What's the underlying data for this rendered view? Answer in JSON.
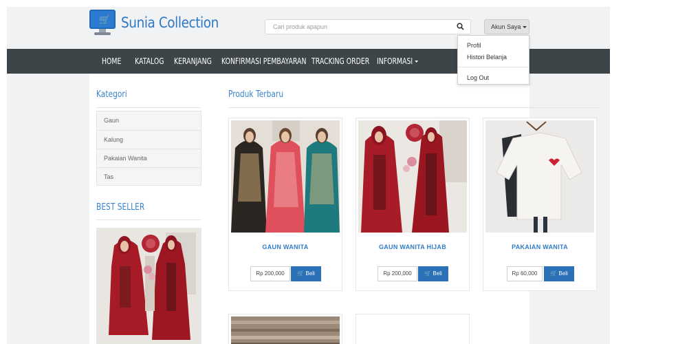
{
  "header": {
    "brand": "Sunia Collection",
    "search_placeholder": "Cari produk apapun",
    "account_label": "Akun Saya"
  },
  "account_menu": [
    "Profil",
    "Histori Belanja",
    "Log Out"
  ],
  "nav": [
    "HOME",
    "KATALOG",
    "KERANJANG",
    "KONFIRMASI PEMBAYARAN",
    "TRACKING ORDER",
    "INFORMASI"
  ],
  "sidebar": {
    "category_title": "Kategori",
    "categories": [
      "Gaun",
      "Kalung",
      "Pakaian Wanita",
      "Tas"
    ],
    "bestseller_title": "BEST SELLER"
  },
  "main": {
    "title": "Produk Terbaru",
    "products": [
      {
        "name": "GAUN WANITA",
        "price": "Rp 200,000",
        "buy_label": "Beli"
      },
      {
        "name": "GAUN WANITA HIJAB",
        "price": "Rp 200,000",
        "buy_label": "Beli"
      },
      {
        "name": "PAKAIAN WANITA",
        "price": "Rp 60,000",
        "buy_label": "Beli"
      }
    ]
  },
  "colors": {
    "accent": "#2e78c5",
    "navbar": "#3d4549",
    "button": "#2a71b8"
  }
}
